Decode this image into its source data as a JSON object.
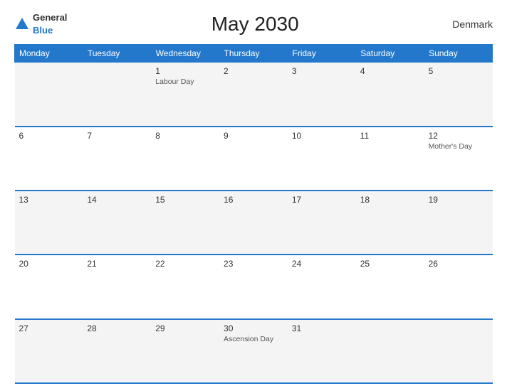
{
  "header": {
    "logo_general": "General",
    "logo_blue": "Blue",
    "title": "May 2030",
    "country": "Denmark"
  },
  "weekdays": [
    "Monday",
    "Tuesday",
    "Wednesday",
    "Thursday",
    "Friday",
    "Saturday",
    "Sunday"
  ],
  "weeks": [
    [
      {
        "day": "",
        "holiday": ""
      },
      {
        "day": "",
        "holiday": ""
      },
      {
        "day": "1",
        "holiday": "Labour Day"
      },
      {
        "day": "2",
        "holiday": ""
      },
      {
        "day": "3",
        "holiday": ""
      },
      {
        "day": "4",
        "holiday": ""
      },
      {
        "day": "5",
        "holiday": ""
      }
    ],
    [
      {
        "day": "6",
        "holiday": ""
      },
      {
        "day": "7",
        "holiday": ""
      },
      {
        "day": "8",
        "holiday": ""
      },
      {
        "day": "9",
        "holiday": ""
      },
      {
        "day": "10",
        "holiday": ""
      },
      {
        "day": "11",
        "holiday": ""
      },
      {
        "day": "12",
        "holiday": "Mother's Day"
      }
    ],
    [
      {
        "day": "13",
        "holiday": ""
      },
      {
        "day": "14",
        "holiday": ""
      },
      {
        "day": "15",
        "holiday": ""
      },
      {
        "day": "16",
        "holiday": ""
      },
      {
        "day": "17",
        "holiday": ""
      },
      {
        "day": "18",
        "holiday": ""
      },
      {
        "day": "19",
        "holiday": ""
      }
    ],
    [
      {
        "day": "20",
        "holiday": ""
      },
      {
        "day": "21",
        "holiday": ""
      },
      {
        "day": "22",
        "holiday": ""
      },
      {
        "day": "23",
        "holiday": ""
      },
      {
        "day": "24",
        "holiday": ""
      },
      {
        "day": "25",
        "holiday": ""
      },
      {
        "day": "26",
        "holiday": ""
      }
    ],
    [
      {
        "day": "27",
        "holiday": ""
      },
      {
        "day": "28",
        "holiday": ""
      },
      {
        "day": "29",
        "holiday": ""
      },
      {
        "day": "30",
        "holiday": "Ascension Day"
      },
      {
        "day": "31",
        "holiday": ""
      },
      {
        "day": "",
        "holiday": ""
      },
      {
        "day": "",
        "holiday": ""
      }
    ]
  ]
}
